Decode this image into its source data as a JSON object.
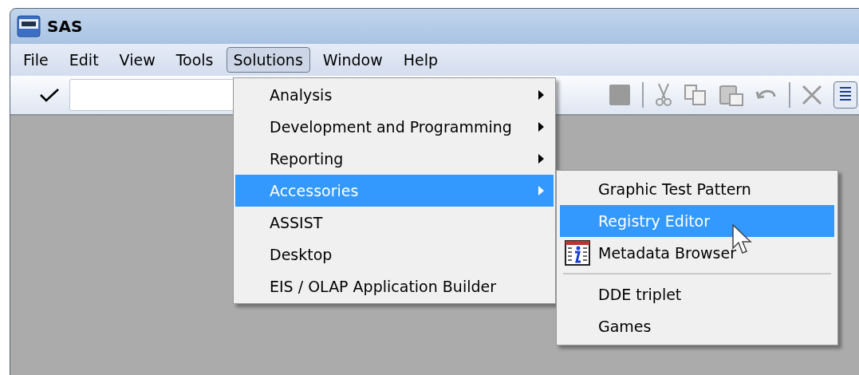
{
  "window": {
    "title": "SAS"
  },
  "menubar": [
    {
      "label": "File",
      "selected": false
    },
    {
      "label": "Edit",
      "selected": false
    },
    {
      "label": "View",
      "selected": false
    },
    {
      "label": "Tools",
      "selected": false
    },
    {
      "label": "Solutions",
      "selected": true
    },
    {
      "label": "Window",
      "selected": false
    },
    {
      "label": "Help",
      "selected": false
    }
  ],
  "solutions_menu": [
    {
      "label": "Analysis",
      "submenu": true,
      "selected": false
    },
    {
      "label": "Development and Programming",
      "submenu": true,
      "selected": false
    },
    {
      "label": "Reporting",
      "submenu": true,
      "selected": false
    },
    {
      "label": "Accessories",
      "submenu": true,
      "selected": true
    },
    {
      "label": "ASSIST",
      "submenu": false,
      "selected": false
    },
    {
      "label": "Desktop",
      "submenu": false,
      "selected": false
    },
    {
      "label": "EIS / OLAP Application Builder",
      "submenu": false,
      "selected": false
    }
  ],
  "accessories_menu": [
    {
      "kind": "item",
      "label": "Graphic Test Pattern",
      "selected": false
    },
    {
      "kind": "item",
      "label": "Registry Editor",
      "selected": true
    },
    {
      "kind": "icon-item",
      "label": "Metadata Browser",
      "selected": false
    },
    {
      "kind": "separator"
    },
    {
      "kind": "item",
      "label": "DDE triplet",
      "selected": false
    },
    {
      "kind": "item",
      "label": "Games",
      "selected": false
    }
  ]
}
